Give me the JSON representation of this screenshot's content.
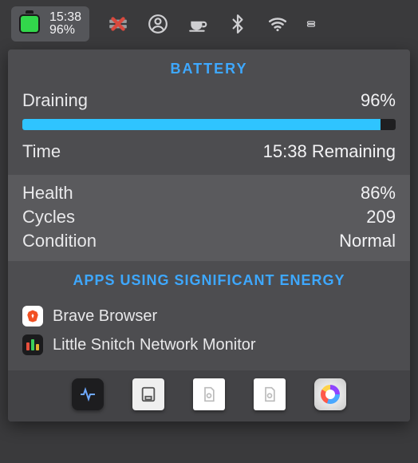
{
  "menubar": {
    "battery_time": "15:38",
    "battery_percent": "96%"
  },
  "panel": {
    "title": "BATTERY",
    "status_label": "Draining",
    "status_value": "96%",
    "progress_percent": 96,
    "time_label": "Time",
    "time_value": "15:38 Remaining",
    "health_label": "Health",
    "health_value": "86%",
    "cycles_label": "Cycles",
    "cycles_value": "209",
    "condition_label": "Condition",
    "condition_value": "Normal",
    "apps_title": "APPS USING SIGNIFICANT ENERGY",
    "apps": [
      {
        "name": "Brave Browser"
      },
      {
        "name": "Little Snitch Network Monitor"
      }
    ]
  }
}
